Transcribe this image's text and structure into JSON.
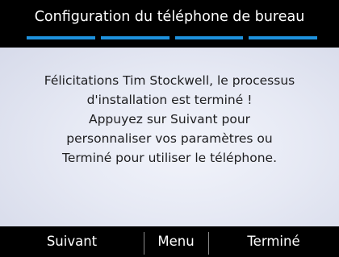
{
  "header": {
    "title": "Configuration du téléphone de bureau",
    "progress": {
      "total_steps": 4,
      "completed_steps": 4
    }
  },
  "message": {
    "lines": [
      "Félicitations Tim Stockwell, le processus",
      "d'installation est terminé !",
      "Appuyez sur Suivant pour",
      "personnaliser vos paramètres ou",
      "Terminé pour utiliser le téléphone."
    ]
  },
  "softkeys": {
    "next_label": "Suivant",
    "menu_label": "Menu",
    "done_label": "Terminé"
  },
  "colors": {
    "accent": "#1e92de",
    "background": "#000000",
    "content_background": "#e6e9f4"
  }
}
